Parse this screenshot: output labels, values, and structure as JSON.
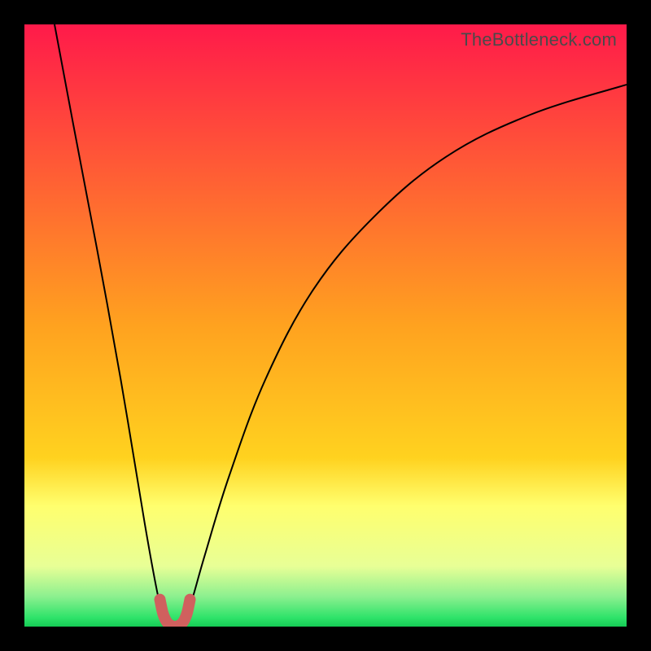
{
  "attribution": "TheBottleneck.com",
  "colors": {
    "frame": "#000000",
    "top": "#ff1a4a",
    "mid": "#ffd21f",
    "lowYellow": "#ffff6e",
    "paleGreen": "#baf7a1",
    "green": "#2fe36a",
    "floorGreen": "#15cc55",
    "highlight": "#d0605e",
    "curve": "#000000"
  },
  "chart_data": {
    "type": "line",
    "title": "",
    "xlabel": "",
    "ylabel": "",
    "xlim": [
      0,
      100
    ],
    "ylim": [
      0,
      100
    ],
    "grid": false,
    "series": [
      {
        "name": "bottleneck-curve",
        "x": [
          5,
          8,
          12,
          16,
          20,
          22,
          23,
          24,
          25,
          26,
          27,
          28,
          30,
          34,
          40,
          48,
          58,
          70,
          84,
          100
        ],
        "y": [
          100,
          84,
          63,
          41,
          17,
          6,
          2,
          0.5,
          0,
          0.5,
          2,
          5,
          12,
          25,
          41,
          56,
          68,
          78,
          85,
          90
        ]
      }
    ],
    "highlight": {
      "x": [
        22.5,
        23,
        23.5,
        24,
        24.5,
        25,
        25.5,
        26,
        26.5,
        27,
        27.5
      ],
      "y": [
        4.5,
        2.2,
        1.0,
        0.4,
        0.1,
        0,
        0.1,
        0.4,
        1.0,
        2.2,
        4.5
      ]
    },
    "background_gradient_stops": [
      {
        "pos": 0.0,
        "color": "#ff1a4a"
      },
      {
        "pos": 0.5,
        "color": "#ffa21f"
      },
      {
        "pos": 0.72,
        "color": "#ffd21f"
      },
      {
        "pos": 0.8,
        "color": "#ffff6e"
      },
      {
        "pos": 0.9,
        "color": "#e8ff96"
      },
      {
        "pos": 0.95,
        "color": "#8cf08f"
      },
      {
        "pos": 0.985,
        "color": "#2fe36a"
      },
      {
        "pos": 1.0,
        "color": "#15cc55"
      }
    ]
  }
}
